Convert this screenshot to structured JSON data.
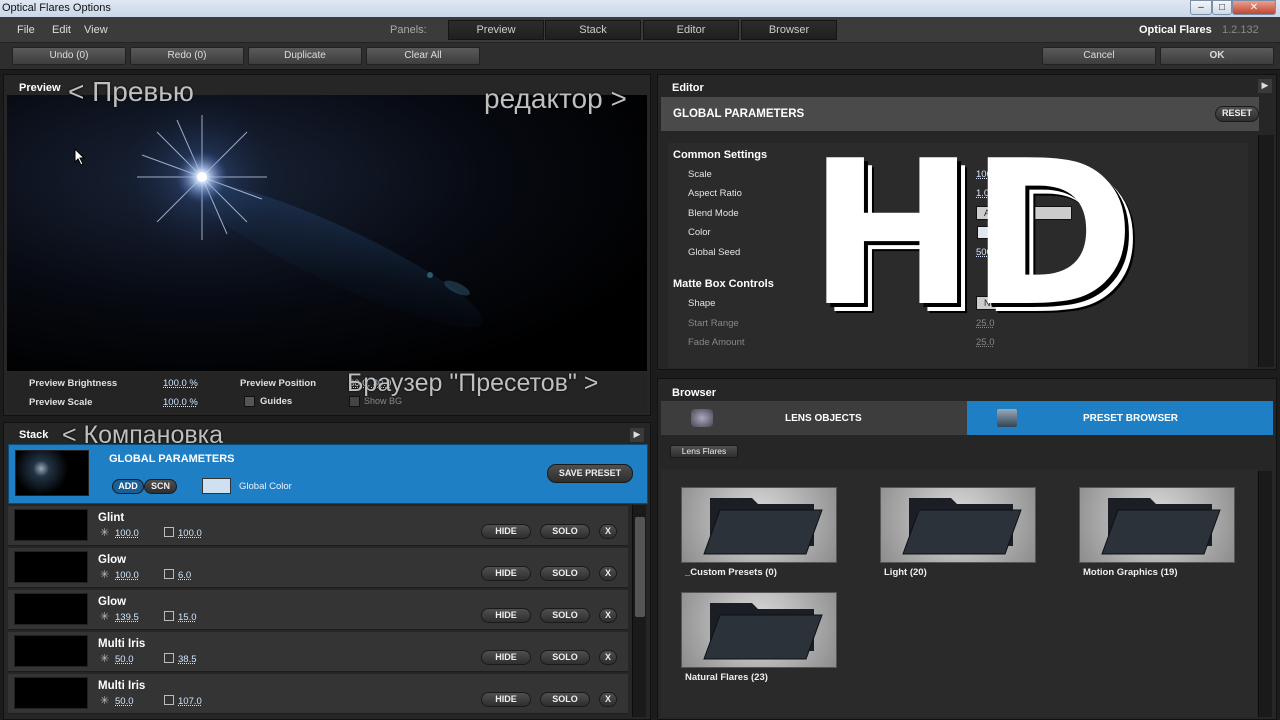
{
  "window": {
    "title": "Optical Flares Options",
    "min": "–",
    "max": "□",
    "close": "✕"
  },
  "menu": [
    "File",
    "Edit",
    "View"
  ],
  "panels_label": "Panels:",
  "panel_buttons": [
    "Preview",
    "Stack",
    "Editor",
    "Browser"
  ],
  "brand": "Optical Flares",
  "version": "1.2.132",
  "toolbar": {
    "undo": "Undo (0)",
    "redo": "Redo (0)",
    "duplicate": "Duplicate",
    "clear": "Clear All",
    "cancel": "Cancel",
    "ok": "OK"
  },
  "preview": {
    "title": "Preview",
    "overlay_left": "< Превью",
    "overlay_right": "редактор >",
    "brightness_label": "Preview Brightness",
    "brightness_value": "100.0 %",
    "scale_label": "Preview Scale",
    "scale_value": "100.0 %",
    "position_label": "Preview Position",
    "position_value": "30.0, 30.0",
    "guides_label": "Guides",
    "showbg_label": "Show BG",
    "overlay_browser": "Браузер \"Пресетов\" >"
  },
  "stack": {
    "title": "Stack",
    "overlay": "< Компановка",
    "global": {
      "title": "GLOBAL PARAMETERS",
      "add": "ADD",
      "scn": "SCN",
      "global_color": "Global Color",
      "save_preset": "SAVE PRESET"
    },
    "hide": "HIDE",
    "solo": "SOLO",
    "x": "X",
    "rows": [
      {
        "name": "Glint",
        "v1": "100.0",
        "v2": "100.0"
      },
      {
        "name": "Glow",
        "v1": "100.0",
        "v2": "6.0"
      },
      {
        "name": "Glow",
        "v1": "139.5",
        "v2": "15.0"
      },
      {
        "name": "Multi Iris",
        "v1": "50.0",
        "v2": "38.5"
      },
      {
        "name": "Multi Iris",
        "v1": "50.0",
        "v2": "107.0"
      }
    ]
  },
  "editor": {
    "title": "Editor",
    "header": "GLOBAL PARAMETERS",
    "reset": "RESET",
    "section1": "Common Settings",
    "scale_label": "Scale",
    "scale_value": "100.0",
    "aspect_label": "Aspect Ratio",
    "aspect_value": "1.00",
    "blend_label": "Blend Mode",
    "blend_value": "Add",
    "color_label": "Color",
    "seed_label": "Global Seed",
    "seed_value": "5000",
    "section2": "Matte Box Controls",
    "shape_label": "Shape",
    "shape_value": "None",
    "start_label": "Start Range",
    "start_value": "25.0",
    "fade_label": "Fade Amount",
    "fade_value": "25.0",
    "watermark": "HD"
  },
  "browser": {
    "title": "Browser",
    "tab_lens": "LENS OBJECTS",
    "tab_preset": "PRESET BROWSER",
    "crumb": "Lens Flares",
    "folders": [
      "_Custom Presets (0)",
      "Light (20)",
      "Motion Graphics (19)",
      "Natural Flares (23)"
    ]
  },
  "colors": {
    "accent": "#1f7fc4",
    "bg": "#262626"
  }
}
